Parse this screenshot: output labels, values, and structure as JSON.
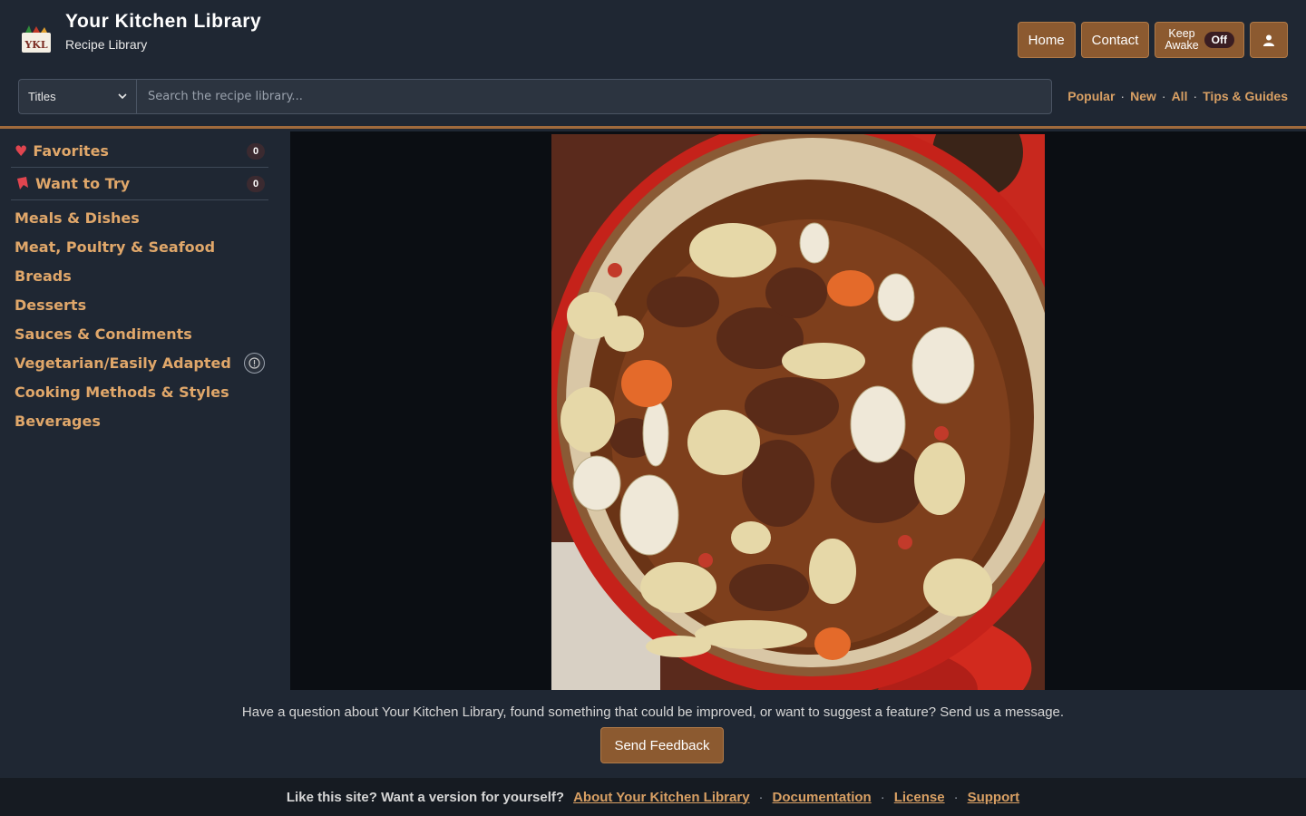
{
  "header": {
    "title": "Your Kitchen Library",
    "subtitle": "Recipe Library",
    "logo_text": "YKL",
    "buttons": {
      "home": "Home",
      "contact": "Contact",
      "keep_awake_line1": "Keep",
      "keep_awake_line2": "Awake",
      "keep_awake_state": "Off"
    }
  },
  "search": {
    "mode": "Titles",
    "placeholder": "Search the recipe library..."
  },
  "quick_links": [
    "Popular",
    "New",
    "All",
    "Tips & Guides"
  ],
  "sidebar": {
    "favorites": {
      "label": "Favorites",
      "count": "0"
    },
    "want_to_try": {
      "label": "Want to Try",
      "count": "0"
    },
    "categories": [
      "Meals & Dishes",
      "Meat, Poultry & Seafood",
      "Breads",
      "Desserts",
      "Sauces & Condiments",
      "Vegetarian/Easily Adapted",
      "Cooking Methods & Styles",
      "Beverages"
    ]
  },
  "feedback": {
    "text": "Have a question about Your Kitchen Library, found something that could be improved, or want to suggest a feature? Send us a message.",
    "button": "Send Feedback"
  },
  "footer": {
    "text": "Like this site? Want a version for yourself?",
    "links": [
      "About Your Kitchen Library",
      "Documentation",
      "License",
      "Support"
    ]
  },
  "colors": {
    "accent": "#8c5a30",
    "link": "#d9a064",
    "background": "#1f2733"
  }
}
